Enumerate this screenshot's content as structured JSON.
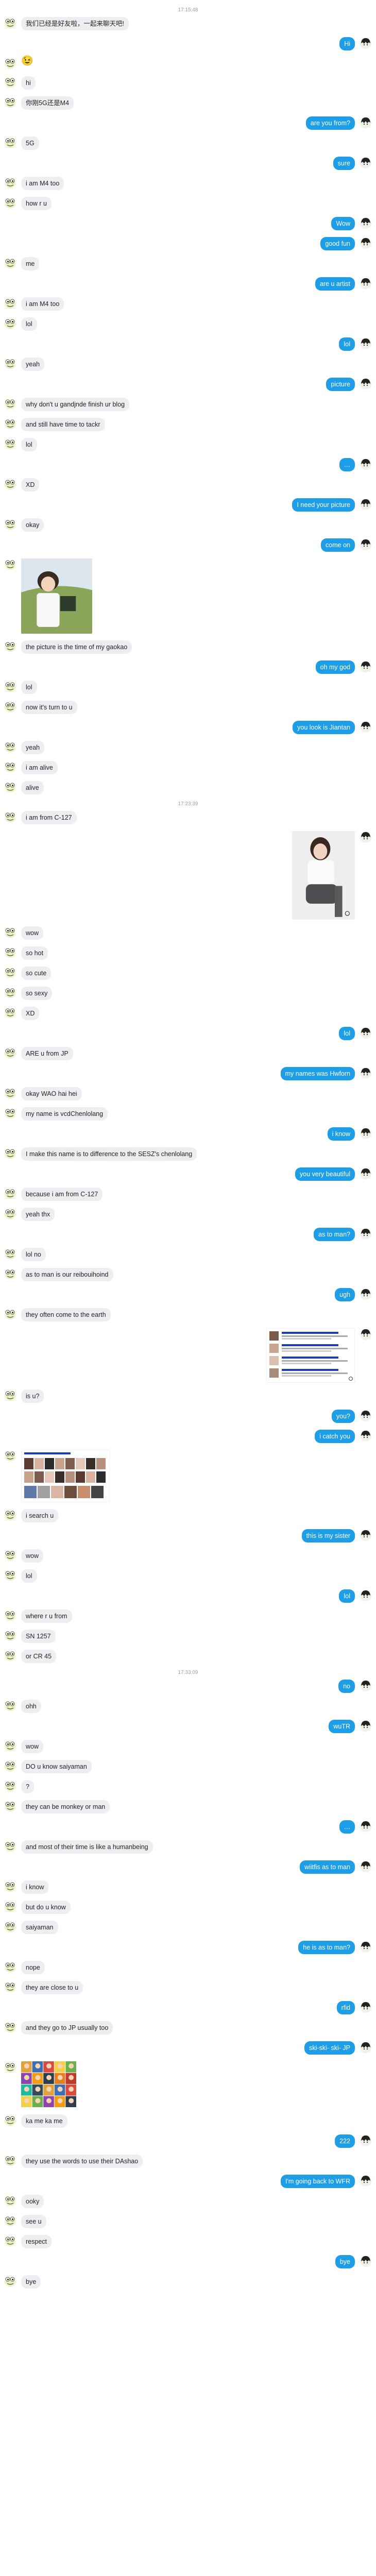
{
  "messages": [
    {
      "type": "time",
      "text": "17:15:48"
    },
    {
      "type": "msg",
      "from": "in",
      "text": "我们已经是好友啦，一起来聊天吧!"
    },
    {
      "type": "msg",
      "from": "out",
      "text": "Hi"
    },
    {
      "type": "msg",
      "from": "in",
      "text": "😉",
      "emoji": true
    },
    {
      "type": "msg",
      "from": "in",
      "text": "hi"
    },
    {
      "type": "msg",
      "from": "in",
      "text": "你刚5G还是M4"
    },
    {
      "type": "msg",
      "from": "out",
      "text": "are you from?"
    },
    {
      "type": "msg",
      "from": "in",
      "text": "5G"
    },
    {
      "type": "msg",
      "from": "out",
      "text": "sure"
    },
    {
      "type": "msg",
      "from": "in",
      "text": "i am M4 too"
    },
    {
      "type": "msg",
      "from": "in",
      "text": "how r u"
    },
    {
      "type": "msg",
      "from": "out",
      "text": "Wow"
    },
    {
      "type": "msg",
      "from": "out",
      "text": "good fun"
    },
    {
      "type": "msg",
      "from": "in",
      "text": "me"
    },
    {
      "type": "msg",
      "from": "out",
      "text": "are u artist"
    },
    {
      "type": "msg",
      "from": "in",
      "text": "i am M4 too"
    },
    {
      "type": "msg",
      "from": "in",
      "text": "lol"
    },
    {
      "type": "msg",
      "from": "out",
      "text": "lol"
    },
    {
      "type": "msg",
      "from": "in",
      "text": "yeah"
    },
    {
      "type": "msg",
      "from": "out",
      "text": "picture"
    },
    {
      "type": "msg",
      "from": "in",
      "text": "why don't u gandjnde finish ur blog"
    },
    {
      "type": "msg",
      "from": "in",
      "text": "and still have time to tackr"
    },
    {
      "type": "msg",
      "from": "in",
      "text": "lol"
    },
    {
      "type": "msg",
      "from": "out",
      "text": "…"
    },
    {
      "type": "msg",
      "from": "in",
      "text": "XD"
    },
    {
      "type": "msg",
      "from": "out",
      "text": "I need your picture"
    },
    {
      "type": "msg",
      "from": "in",
      "text": "okay"
    },
    {
      "type": "msg",
      "from": "out",
      "text": "come on"
    },
    {
      "type": "image",
      "from": "in",
      "kind": "photo1",
      "w": 138,
      "h": 146
    },
    {
      "type": "msg",
      "from": "in",
      "text": "the picture is the time of my gaokao"
    },
    {
      "type": "msg",
      "from": "out",
      "text": "oh my god"
    },
    {
      "type": "msg",
      "from": "in",
      "text": "lol"
    },
    {
      "type": "msg",
      "from": "in",
      "text": "now it's turn to u"
    },
    {
      "type": "msg",
      "from": "out",
      "text": "you look is Jiantan"
    },
    {
      "type": "msg",
      "from": "in",
      "text": "yeah"
    },
    {
      "type": "msg",
      "from": "in",
      "text": "i am alive"
    },
    {
      "type": "msg",
      "from": "in",
      "text": "alive"
    },
    {
      "type": "time",
      "text": "17:23:39"
    },
    {
      "type": "msg",
      "from": "in",
      "text": "i am from C-127"
    },
    {
      "type": "image",
      "from": "out",
      "kind": "photo2",
      "w": 122,
      "h": 172
    },
    {
      "type": "msg",
      "from": "in",
      "text": "wow"
    },
    {
      "type": "msg",
      "from": "in",
      "text": "so hot"
    },
    {
      "type": "msg",
      "from": "in",
      "text": "so cute"
    },
    {
      "type": "msg",
      "from": "in",
      "text": "so sexy"
    },
    {
      "type": "msg",
      "from": "in",
      "text": "XD"
    },
    {
      "type": "msg",
      "from": "out",
      "text": "lol"
    },
    {
      "type": "msg",
      "from": "in",
      "text": "ARE u from JP"
    },
    {
      "type": "msg",
      "from": "out",
      "text": "my names was Hwforn"
    },
    {
      "type": "msg",
      "from": "in",
      "text": "okay WAO hai hei"
    },
    {
      "type": "msg",
      "from": "in",
      "text": "my name is vcdChenlolang"
    },
    {
      "type": "msg",
      "from": "out",
      "text": "i know"
    },
    {
      "type": "msg",
      "from": "in",
      "text": "I make this name is to difference to the SESZ's chenlolang"
    },
    {
      "type": "msg",
      "from": "out",
      "text": "you very beautiful"
    },
    {
      "type": "msg",
      "from": "in",
      "text": "because i am from C-127"
    },
    {
      "type": "msg",
      "from": "in",
      "text": "yeah thx"
    },
    {
      "type": "msg",
      "from": "out",
      "text": "as to man?"
    },
    {
      "type": "msg",
      "from": "in",
      "text": "lol no"
    },
    {
      "type": "msg",
      "from": "in",
      "text": "as to man is our reibouihoind"
    },
    {
      "type": "msg",
      "from": "out",
      "text": "ugh"
    },
    {
      "type": "msg",
      "from": "in",
      "text": "they often come to the earth"
    },
    {
      "type": "image",
      "from": "out",
      "kind": "search",
      "w": 172,
      "h": 106
    },
    {
      "type": "msg",
      "from": "in",
      "text": "is u?"
    },
    {
      "type": "msg",
      "from": "out",
      "text": "you?"
    },
    {
      "type": "msg",
      "from": "out",
      "text": "i catch you"
    },
    {
      "type": "image",
      "from": "in",
      "kind": "faces",
      "w": 172,
      "h": 102
    },
    {
      "type": "msg",
      "from": "in",
      "text": "i search u"
    },
    {
      "type": "msg",
      "from": "out",
      "text": "this is my sister"
    },
    {
      "type": "msg",
      "from": "in",
      "text": "wow"
    },
    {
      "type": "msg",
      "from": "in",
      "text": "lol"
    },
    {
      "type": "msg",
      "from": "out",
      "text": "lol"
    },
    {
      "type": "msg",
      "from": "in",
      "text": "where r u from"
    },
    {
      "type": "msg",
      "from": "in",
      "text": "SN 1257"
    },
    {
      "type": "msg",
      "from": "in",
      "text": "or CR 45"
    },
    {
      "type": "time",
      "text": "17:33:09"
    },
    {
      "type": "msg",
      "from": "out",
      "text": "no"
    },
    {
      "type": "msg",
      "from": "in",
      "text": "ohh"
    },
    {
      "type": "msg",
      "from": "out",
      "text": "wuTR"
    },
    {
      "type": "msg",
      "from": "in",
      "text": "wow"
    },
    {
      "type": "msg",
      "from": "in",
      "text": "DO u know saiyaman"
    },
    {
      "type": "msg",
      "from": "in",
      "text": "?"
    },
    {
      "type": "msg",
      "from": "in",
      "text": "they can be monkey or man"
    },
    {
      "type": "msg",
      "from": "out",
      "text": "…"
    },
    {
      "type": "msg",
      "from": "in",
      "text": "and most of their time is like a humanbeing"
    },
    {
      "type": "msg",
      "from": "out",
      "text": "wiitfis as to man"
    },
    {
      "type": "msg",
      "from": "in",
      "text": "i know"
    },
    {
      "type": "msg",
      "from": "in",
      "text": "but do u know"
    },
    {
      "type": "msg",
      "from": "in",
      "text": "saiyaman"
    },
    {
      "type": "msg",
      "from": "out",
      "text": "he is as to man?"
    },
    {
      "type": "msg",
      "from": "in",
      "text": "nope"
    },
    {
      "type": "msg",
      "from": "in",
      "text": "they are close to u"
    },
    {
      "type": "msg",
      "from": "out",
      "text": "rfid"
    },
    {
      "type": "msg",
      "from": "in",
      "text": "and they go to JP usually too"
    },
    {
      "type": "msg",
      "from": "out",
      "text": "ski-ski- ski- JP"
    },
    {
      "type": "image",
      "from": "in",
      "kind": "manga",
      "w": 108,
      "h": 90
    },
    {
      "type": "msg",
      "from": "in",
      "text": "ka me ka me"
    },
    {
      "type": "msg",
      "from": "out",
      "text": "222"
    },
    {
      "type": "msg",
      "from": "in",
      "text": "they use the words to use their DAshao"
    },
    {
      "type": "msg",
      "from": "out",
      "text": "I'm going back to WFR"
    },
    {
      "type": "msg",
      "from": "in",
      "text": "ooky"
    },
    {
      "type": "msg",
      "from": "in",
      "text": "see u"
    },
    {
      "type": "msg",
      "from": "in",
      "text": "respect"
    },
    {
      "type": "msg",
      "from": "out",
      "text": "bye"
    },
    {
      "type": "msg",
      "from": "in",
      "text": "bye"
    }
  ],
  "avatars": {
    "in": {
      "icon": "frog-avatar-icon",
      "bg": "#8bbf3f",
      "fg": "#ffffff"
    },
    "out": {
      "icon": "anime-avatar-icon",
      "bg": "#2b2b2b",
      "fg": "#ffffff"
    }
  },
  "colors": {
    "bubble_in": "#eceef1",
    "bubble_out": "#1e9ee6",
    "timestamp": "#9aa0a6"
  }
}
